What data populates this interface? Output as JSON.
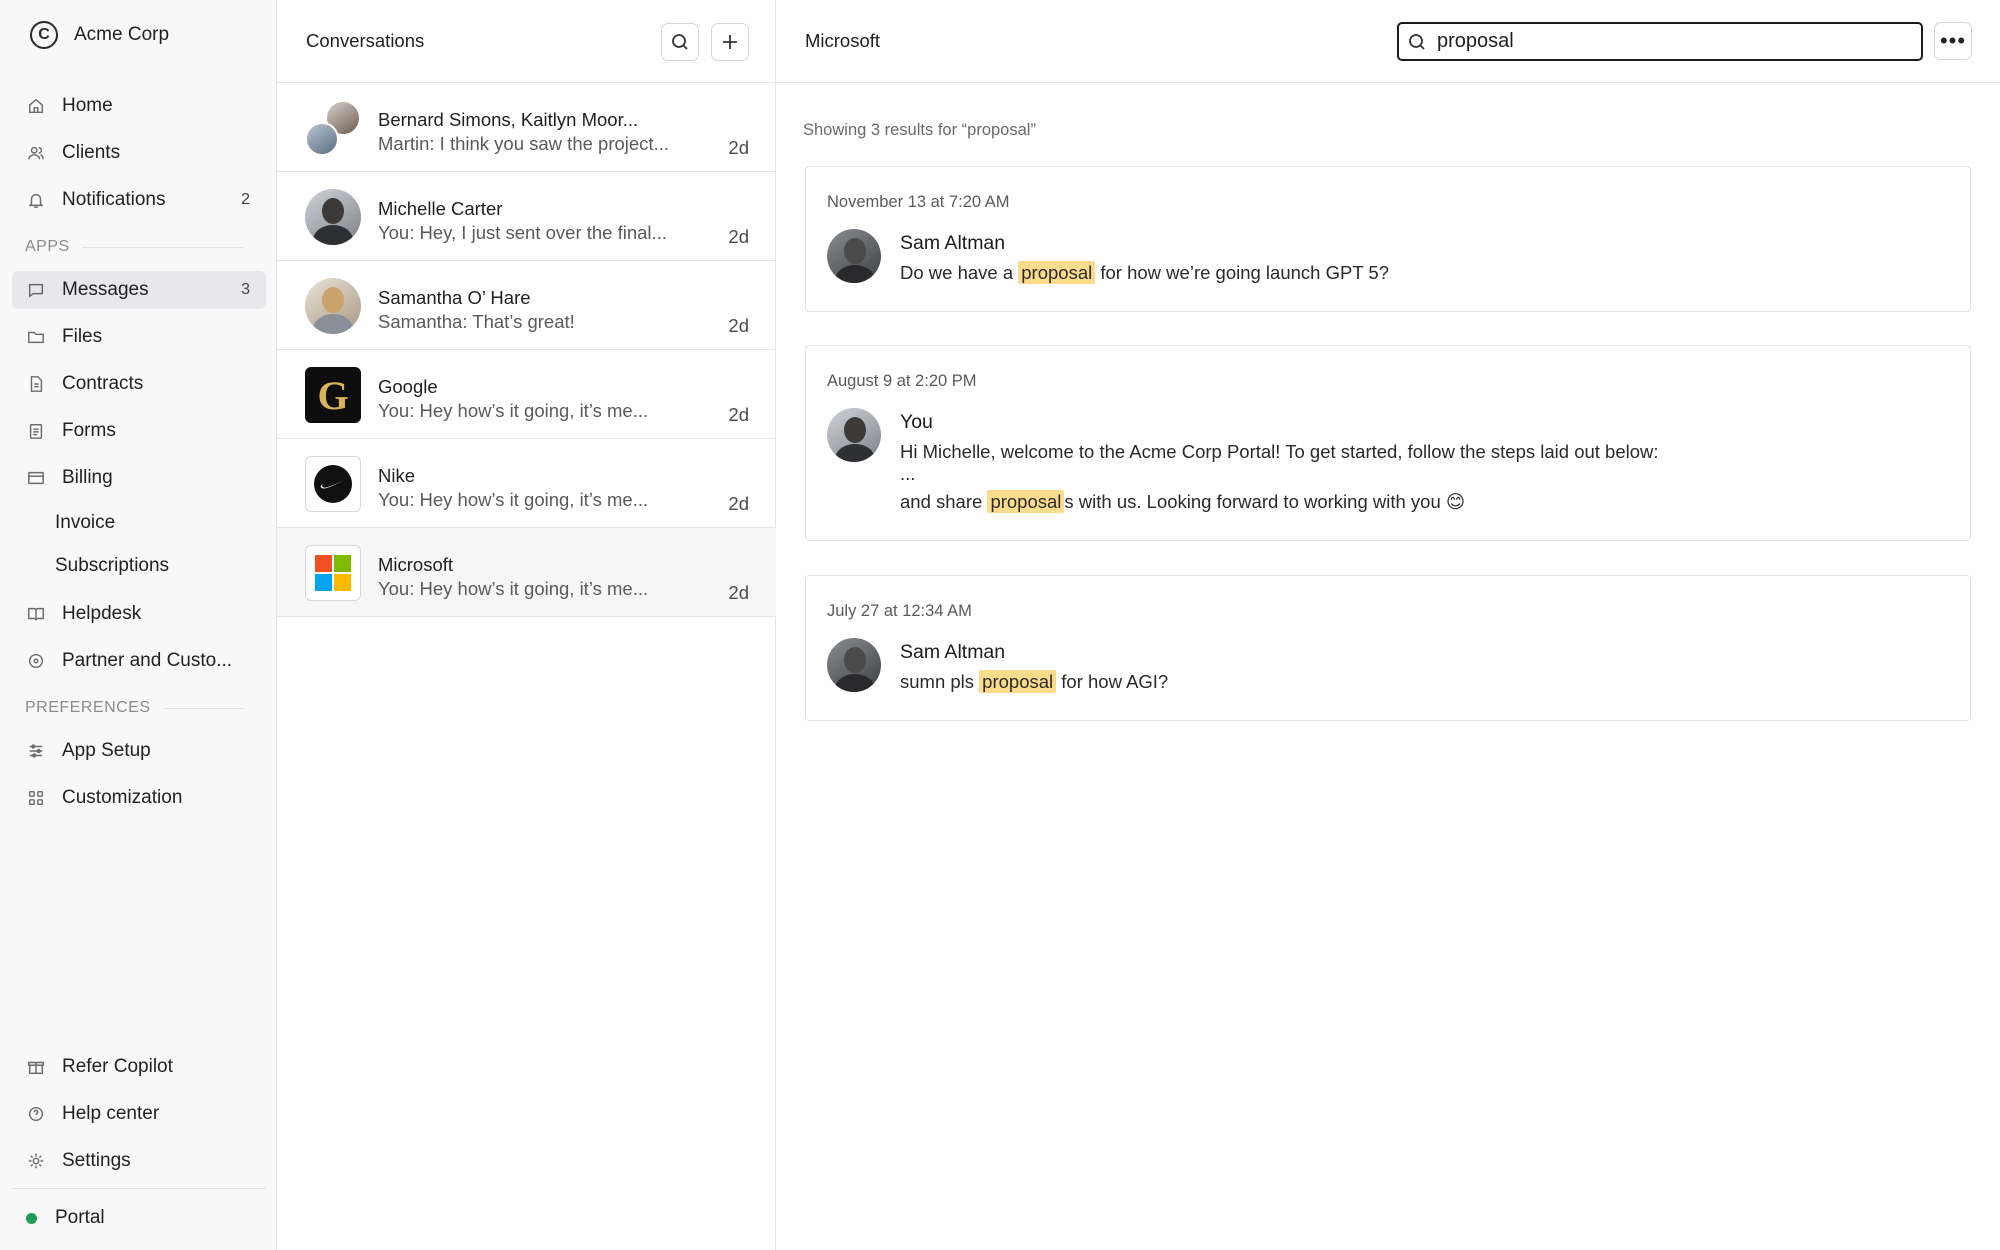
{
  "sidebar": {
    "brand": "Acme Corp",
    "nav": {
      "home": "Home",
      "clients": "Clients",
      "notifications": "Notifications",
      "notifications_count": "2"
    },
    "apps_section": "APPS",
    "apps": {
      "messages": "Messages",
      "messages_count": "3",
      "files": "Files",
      "contracts": "Contracts",
      "forms": "Forms",
      "billing": "Billing",
      "invoice": "Invoice",
      "subscriptions": "Subscriptions",
      "helpdesk": "Helpdesk",
      "partner": "Partner and Custo..."
    },
    "preferences_section": "PREFERENCES",
    "preferences": {
      "app_setup": "App Setup",
      "customization": "Customization"
    },
    "footer": {
      "refer": "Refer Copilot",
      "help": "Help center",
      "settings": "Settings",
      "portal": "Portal"
    }
  },
  "conversations": {
    "title": "Conversations",
    "items": [
      {
        "name": "Bernard Simons, Kaitlyn Moor...",
        "preview": "Martin: I think you saw the project...",
        "time": "2d"
      },
      {
        "name": "Michelle Carter",
        "preview": "You: Hey, I just sent over the final...",
        "time": "2d"
      },
      {
        "name": "Samantha O’ Hare",
        "preview": "Samantha: That’s great!",
        "time": "2d"
      },
      {
        "name": "Google",
        "preview": "You: Hey how’s it going, it’s me...",
        "time": "2d"
      },
      {
        "name": "Nike",
        "preview": "You: Hey how’s it going, it’s me...",
        "time": "2d"
      },
      {
        "name": "Microsoft",
        "preview": "You: Hey how’s it going, it’s me...",
        "time": "2d"
      }
    ]
  },
  "main": {
    "title": "Microsoft",
    "search_value": "proposal",
    "results_label": "Showing 3 results for “proposal”",
    "results": [
      {
        "date": "November 13 at 7:20 AM",
        "sender": "Sam Altman",
        "text_before": "Do we have a ",
        "highlight": "proposal",
        "text_after": " for how we’re going launch GPT 5?"
      },
      {
        "date": "August 9 at 2:20 PM",
        "sender": "You",
        "line1": "Hi Michelle, welcome to the Acme Corp Portal! To get started, follow the steps laid out below:",
        "line2": "...",
        "text_before": "and share ",
        "highlight": "proposal",
        "text_after": "s with us. Looking forward to working with you 😊"
      },
      {
        "date": "July 27 at 12:34 AM",
        "sender": "Sam Altman",
        "text_before": "sumn pls ",
        "highlight": "proposal",
        "text_after": " for how AGI?"
      }
    ]
  },
  "colors": {
    "highlight": "#fbdc8c",
    "active_nav": "#e8e8ec",
    "portal_status": "#1f9d55"
  }
}
